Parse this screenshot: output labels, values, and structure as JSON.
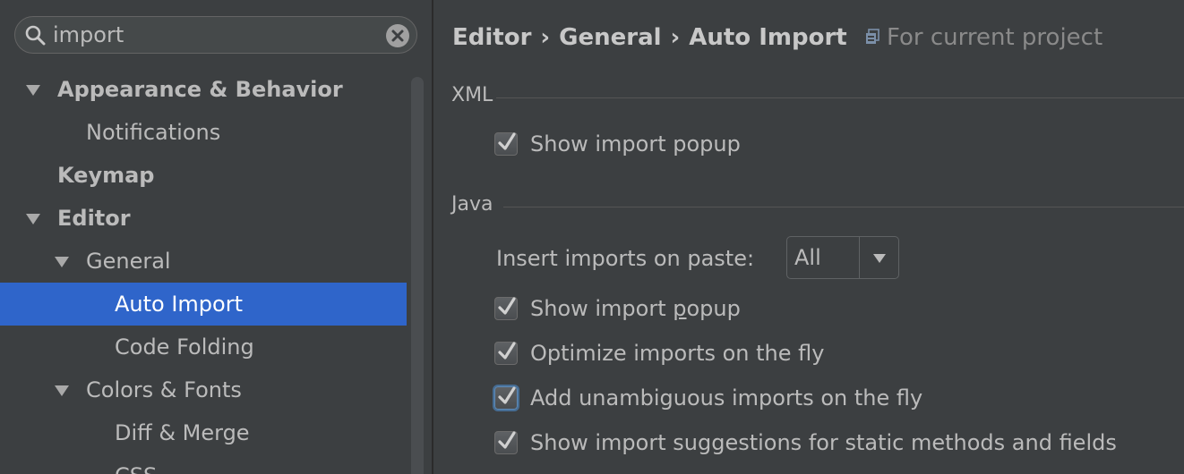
{
  "search": {
    "value": "import"
  },
  "tree": [
    {
      "label": "Appearance & Behavior",
      "level": 0,
      "expanded": true,
      "bold": true
    },
    {
      "label": "Notifications",
      "level": 1,
      "expanded": null,
      "bold": false
    },
    {
      "label": "Keymap",
      "level": 0,
      "expanded": null,
      "bold": true
    },
    {
      "label": "Editor",
      "level": 0,
      "expanded": true,
      "bold": true
    },
    {
      "label": "General",
      "level": 1,
      "expanded": true,
      "bold": false
    },
    {
      "label": "Auto Import",
      "level": 2,
      "expanded": null,
      "bold": false,
      "selected": true
    },
    {
      "label": "Code Folding",
      "level": 2,
      "expanded": null,
      "bold": false
    },
    {
      "label": "Colors & Fonts",
      "level": 1,
      "expanded": true,
      "bold": false
    },
    {
      "label": "Diff & Merge",
      "level": 2,
      "expanded": null,
      "bold": false
    },
    {
      "label": "CSS",
      "level": 2,
      "expanded": null,
      "bold": false
    }
  ],
  "breadcrumb": {
    "items": [
      "Editor",
      "General",
      "Auto Import"
    ],
    "scope": "For current project"
  },
  "xml": {
    "title": "XML",
    "show_popup": {
      "label": "Show import popup",
      "checked": true
    }
  },
  "java": {
    "title": "Java",
    "paste": {
      "label": "Insert imports on paste:",
      "value": "All"
    },
    "options": [
      {
        "name": "java-show-import-popup",
        "label_before": "Show import ",
        "mnemonic": "p",
        "label_after": "opup",
        "checked": true,
        "focused": false
      },
      {
        "name": "java-optimize-imports",
        "label_before": "Optimize imports on the fly",
        "mnemonic": "",
        "label_after": "",
        "checked": true,
        "focused": false
      },
      {
        "name": "java-add-unambiguous",
        "label_before": "Add unambiguous imports on the fly",
        "mnemonic": "",
        "label_after": "",
        "checked": true,
        "focused": true
      },
      {
        "name": "java-static-suggestions",
        "label_before": "Show import suggestions for static methods and fields",
        "mnemonic": "",
        "label_after": "",
        "checked": true,
        "focused": false
      }
    ]
  },
  "colors": {
    "background": "#3c3f41",
    "selection": "#2f65ca",
    "text": "#bbbbbb"
  }
}
